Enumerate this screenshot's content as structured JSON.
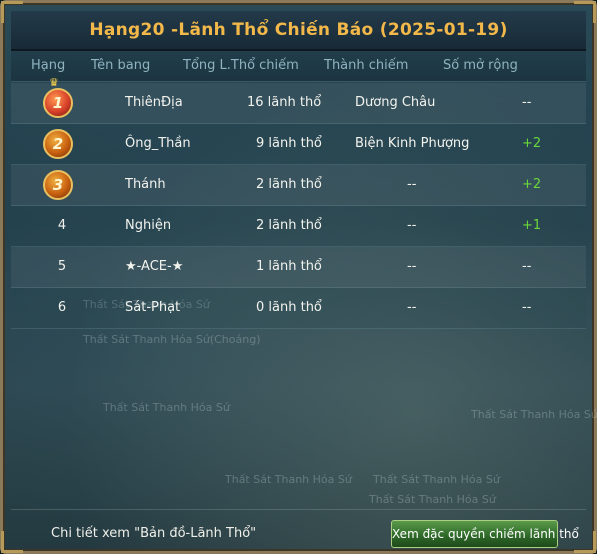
{
  "window": {
    "title": "Hạng20 -Lãnh Thổ Chiến Báo (2025-01-19)"
  },
  "columns": [
    "Hạng",
    "Tên bang",
    "Tổng L.Thổ chiếm",
    "Thành chiếm",
    "Số mở rộng"
  ],
  "rows": [
    {
      "rank": "1",
      "rank_icon": "gold-medal-1-with-crown",
      "guild": "ThiênĐịa",
      "territories": "16 lãnh thổ",
      "city": "Dương Châu",
      "expansion": "--"
    },
    {
      "rank": "2",
      "rank_icon": "medal-2",
      "guild": "Ông_Thần",
      "territories": "9 lãnh thổ",
      "city": "Biện Kinh Phượng",
      "expansion": "+2"
    },
    {
      "rank": "3",
      "rank_icon": "medal-3",
      "guild": "Thánh",
      "territories": "2 lãnh thổ",
      "city": "--",
      "expansion": "+2"
    },
    {
      "rank": "4",
      "guild": "Nghiện",
      "territories": "2 lãnh thổ",
      "city": "--",
      "expansion": "+1"
    },
    {
      "rank": "5",
      "guild": "★-ACE-★",
      "territories": "1 lãnh thổ",
      "city": "--",
      "expansion": "--"
    },
    {
      "rank": "6",
      "guild": "Sát-Phạt",
      "territories": "0 lãnh thổ",
      "city": "--",
      "expansion": "--"
    }
  ],
  "background_text": [
    "Thất Sát Thanh Hóa Sứ",
    "Thất Sát Thanh Hóa Sứ(Choáng)",
    "Thất Sát Thanh Hóa Sứ",
    "Thất Sát Thanh Hóa Sứ",
    "Thất Sát Thanh Hóa Sứ",
    "Thất Sát Thanh Hóa Sứ",
    "Thất Sát Thanh Hóa Sứ"
  ],
  "footer": {
    "hint": "Chi tiết xem \"Bản đồ-Lãnh Thổ\"",
    "button_label": "Xem đặc quyền chiếm lãnh thổ"
  },
  "colors": {
    "title": "#f2b84a",
    "header_text": "#8fb3c0",
    "plus_value": "#6ad83a",
    "button": "#3f7a32"
  }
}
